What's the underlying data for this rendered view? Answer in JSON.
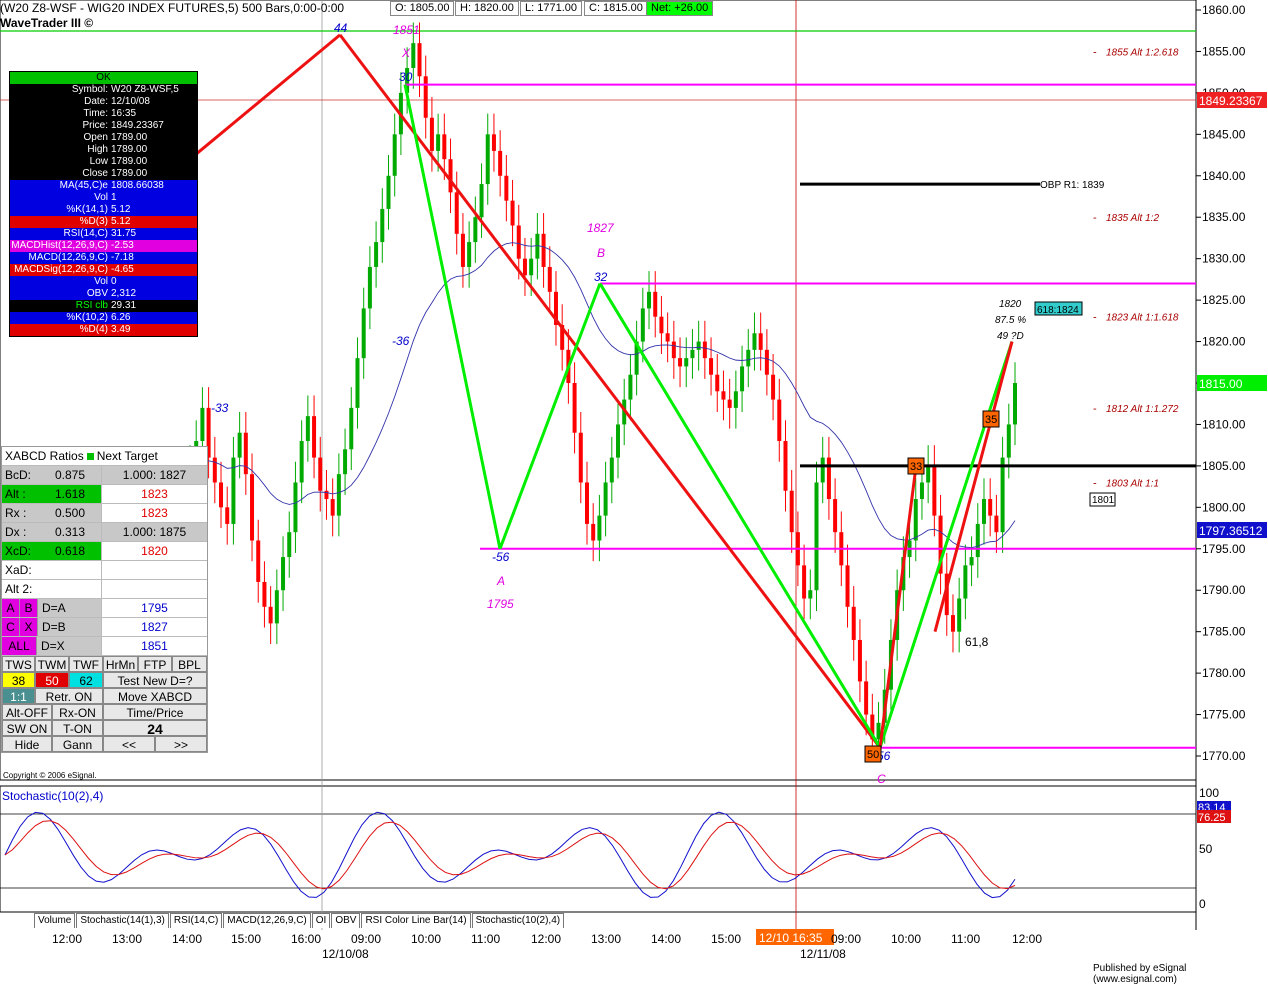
{
  "window": {
    "title": "(W20 Z8-WSF - WIG20 INDEX FUTURES,5) 500 Bars,0:00-0:00",
    "subtitle": "WaveTrader III ©"
  },
  "ohlc": {
    "open": "O: 1805.00",
    "high": "H: 1820.00",
    "low": "L: 1771.00",
    "close": "C: 1815.00",
    "net": "Net: +26.00"
  },
  "info_panel": {
    "header": "OK",
    "rows": [
      {
        "label": "Symbol:",
        "value": "W20 Z8-WSF,5",
        "color": "black"
      },
      {
        "label": "Date:",
        "value": "12/10/08",
        "color": "black"
      },
      {
        "label": "Time:",
        "value": "16:35",
        "color": "black"
      },
      {
        "label": "Price:",
        "value": "1849.23367",
        "color": "black"
      },
      {
        "label": "Open",
        "value": "1789.00",
        "color": "black"
      },
      {
        "label": "High",
        "value": "1789.00",
        "color": "black"
      },
      {
        "label": "Low",
        "value": "1789.00",
        "color": "black"
      },
      {
        "label": "Close",
        "value": "1789.00",
        "color": "black"
      },
      {
        "label": "MA(45,C)e",
        "value": "1808.66038",
        "color": "blue"
      },
      {
        "label": "Vol",
        "value": "1",
        "color": "blue"
      },
      {
        "label": "%K(14,1)",
        "value": "5.12",
        "color": "blue"
      },
      {
        "label": "%D(3)",
        "value": "5.12",
        "color": "red"
      },
      {
        "label": "RSI(14,C)",
        "value": "31.75",
        "color": "blue"
      },
      {
        "label": "MACDHist(12,26,9,C)",
        "value": "-2.53",
        "color": "mag"
      },
      {
        "label": "MACD(12,26,9,C)",
        "value": "-7.18",
        "color": "blue"
      },
      {
        "label": "MACDSig(12,26,9,C)",
        "value": "-4.65",
        "color": "red"
      },
      {
        "label": "Vol",
        "value": "0",
        "color": "blue"
      },
      {
        "label": "OBV",
        "value": "2,312",
        "color": "blue"
      },
      {
        "label": "RSI clb",
        "value": "29.31",
        "color": "black"
      },
      {
        "label": "%K(10,2)",
        "value": "6.26",
        "color": "blue"
      },
      {
        "label": "%D(4)",
        "value": "3.49",
        "color": "red"
      }
    ]
  },
  "xabcd_panel": {
    "title": "XABCD Ratios",
    "next_target": "Next Target",
    "rows": [
      {
        "k": "BcD:",
        "v": "0.875",
        "t": "1.000: 1827"
      },
      {
        "k": "Alt :",
        "v": "1.618",
        "t": "1823"
      },
      {
        "k": "Rx :",
        "v": "0.500",
        "t": "1823"
      },
      {
        "k": "Dx :",
        "v": "0.313",
        "t": "1.000: 1875"
      },
      {
        "k": "XcD:",
        "v": "0.618",
        "t": "1820"
      },
      {
        "k": "XaD:",
        "v": "",
        "t": ""
      },
      {
        "k": "Alt 2:",
        "v": "",
        "t": ""
      }
    ],
    "targets": [
      {
        "a": "A",
        "b": "B",
        "eq": "D=A",
        "val": "1795"
      },
      {
        "a": "C",
        "b": "X",
        "eq": "D=B",
        "val": "1827"
      },
      {
        "a": "ALL",
        "b": "",
        "eq": "D=X",
        "val": "1851"
      }
    ],
    "buttons_row1": [
      "TWS",
      "TWM",
      "TWF",
      "HrMn",
      "FTP",
      "BPL"
    ],
    "nums": [
      "38",
      "50",
      "62"
    ],
    "test_new": "Test New D=?",
    "one_one": "1:1",
    "retr": "Retr. ON",
    "move": "Move XABCD",
    "alt_off": "Alt-OFF",
    "rx_on": "Rx-ON",
    "time_price": "Time/Price",
    "sw_on": "SW ON",
    "t_on": "T-ON",
    "count": "24",
    "hide": "Hide",
    "gann": "Gann",
    "prev": "<<",
    "next": ">>"
  },
  "copyright": "Copyright © 2006 eSignal.",
  "published": "Published by eSignal (www.esignal.com)",
  "stoch_label": "Stochastic(10(2),4)",
  "tabs": [
    "Volume",
    "Stochastic(14(1),3)",
    "RSI(14,C)",
    "MACD(12,26,9,C)",
    "OI",
    "OBV",
    "RSI Color Line Bar(14)",
    "Stochastic(10(2),4)"
  ],
  "colors": {
    "bull": "#00aa00",
    "bear": "#ff0000",
    "magenta": "#ff00ff",
    "green": "#00ee00",
    "red": "#ee1111",
    "blue": "#0000cc"
  },
  "chart_data": {
    "type": "candlestick",
    "y_ticks": [
      "1860.00",
      "1855.00",
      "1850.00",
      "1845.00",
      "1840.00",
      "1835.00",
      "1830.00",
      "1825.00",
      "1820.00",
      "1815.00",
      "1810.00",
      "1805.00",
      "1800.00",
      "1795.00",
      "1790.00",
      "1785.00",
      "1780.00",
      "1775.00",
      "1770.00"
    ],
    "ylim": [
      1765,
      1860
    ],
    "x_ticks": [
      "12:00",
      "13:00",
      "14:00",
      "15:00",
      "16:00",
      "09:00",
      "10:00",
      "11:00",
      "12:00",
      "13:00",
      "14:00",
      "15:00",
      "12/10 16:35",
      "09:00",
      "10:00",
      "11:00",
      "12:00"
    ],
    "date_labels": [
      "12/10/08",
      "12/11/08"
    ],
    "price_badges": [
      {
        "value": "1849.23367",
        "style": "cursor"
      },
      {
        "value": "1815.00",
        "style": "last"
      },
      {
        "value": "1797.36512",
        "style": "ma"
      }
    ],
    "projections": [
      {
        "price": 1855,
        "label": "1855 Alt 1:2.618"
      },
      {
        "price": 1835,
        "label": "1835 Alt 1:2"
      },
      {
        "price": 1823,
        "label": "1823 Alt 1:1.618"
      },
      {
        "price": 1812,
        "label": "1812 Alt 1:1.272"
      },
      {
        "price": 1803,
        "label": "1803 Alt 1:1"
      }
    ],
    "obp_label": "OBP R1: 1839",
    "target_box": "618:1824",
    "d_labels": [
      "1820",
      "87.5 %",
      "49 ?D"
    ],
    "box_1801": "1801",
    "note_618": "61,8",
    "pivots": [
      {
        "name": "X",
        "price": "1851",
        "bars": "30"
      },
      {
        "name": "A",
        "price": "1795",
        "bars": "-56"
      },
      {
        "name": "B",
        "price": "1827",
        "bars": "32"
      },
      {
        "name": "C",
        "price": "",
        "bars": "56"
      }
    ],
    "swing_labels": [
      "44",
      "-33",
      "-36",
      "33",
      "35",
      "50"
    ],
    "stoch_ticks": [
      "100",
      "50",
      "0"
    ],
    "stoch_badges": [
      "83.14",
      "76.25"
    ],
    "closes": [
      1805,
      1808,
      1812,
      1806,
      1803,
      1800,
      1798,
      1806,
      1809,
      1804,
      1796,
      1791,
      1788,
      1786,
      1790,
      1794,
      1797,
      1803,
      1808,
      1811,
      1806,
      1802,
      1801,
      1799,
      1804,
      1807,
      1812,
      1818,
      1824,
      1829,
      1832,
      1836,
      1840,
      1845,
      1850,
      1853,
      1856,
      1852,
      1847,
      1843,
      1845,
      1842,
      1838,
      1833,
      1829,
      1832,
      1835,
      1839,
      1845,
      1843,
      1840,
      1837,
      1834,
      1830,
      1828,
      1830,
      1833,
      1829,
      1826,
      1822,
      1819,
      1815,
      1809,
      1803,
      1798,
      1796,
      1799,
      1803,
      1806,
      1810,
      1813,
      1816,
      1820,
      1824,
      1826,
      1823,
      1821,
      1820,
      1818,
      1817,
      1818,
      1819,
      1820,
      1818,
      1816,
      1814,
      1813,
      1812,
      1814,
      1817,
      1819,
      1821,
      1819,
      1816,
      1813,
      1808,
      1802,
      1797,
      1793,
      1789,
      1790,
      1803,
      1806,
      1801,
      1797,
      1793,
      1788,
      1784,
      1779,
      1775,
      1772,
      1774,
      1778,
      1784,
      1790,
      1794,
      1796,
      1801,
      1803,
      1805,
      1799,
      1792,
      1787,
      1785,
      1789,
      1793,
      1794,
      1798,
      1801,
      1799,
      1797,
      1806,
      1810,
      1815
    ]
  }
}
